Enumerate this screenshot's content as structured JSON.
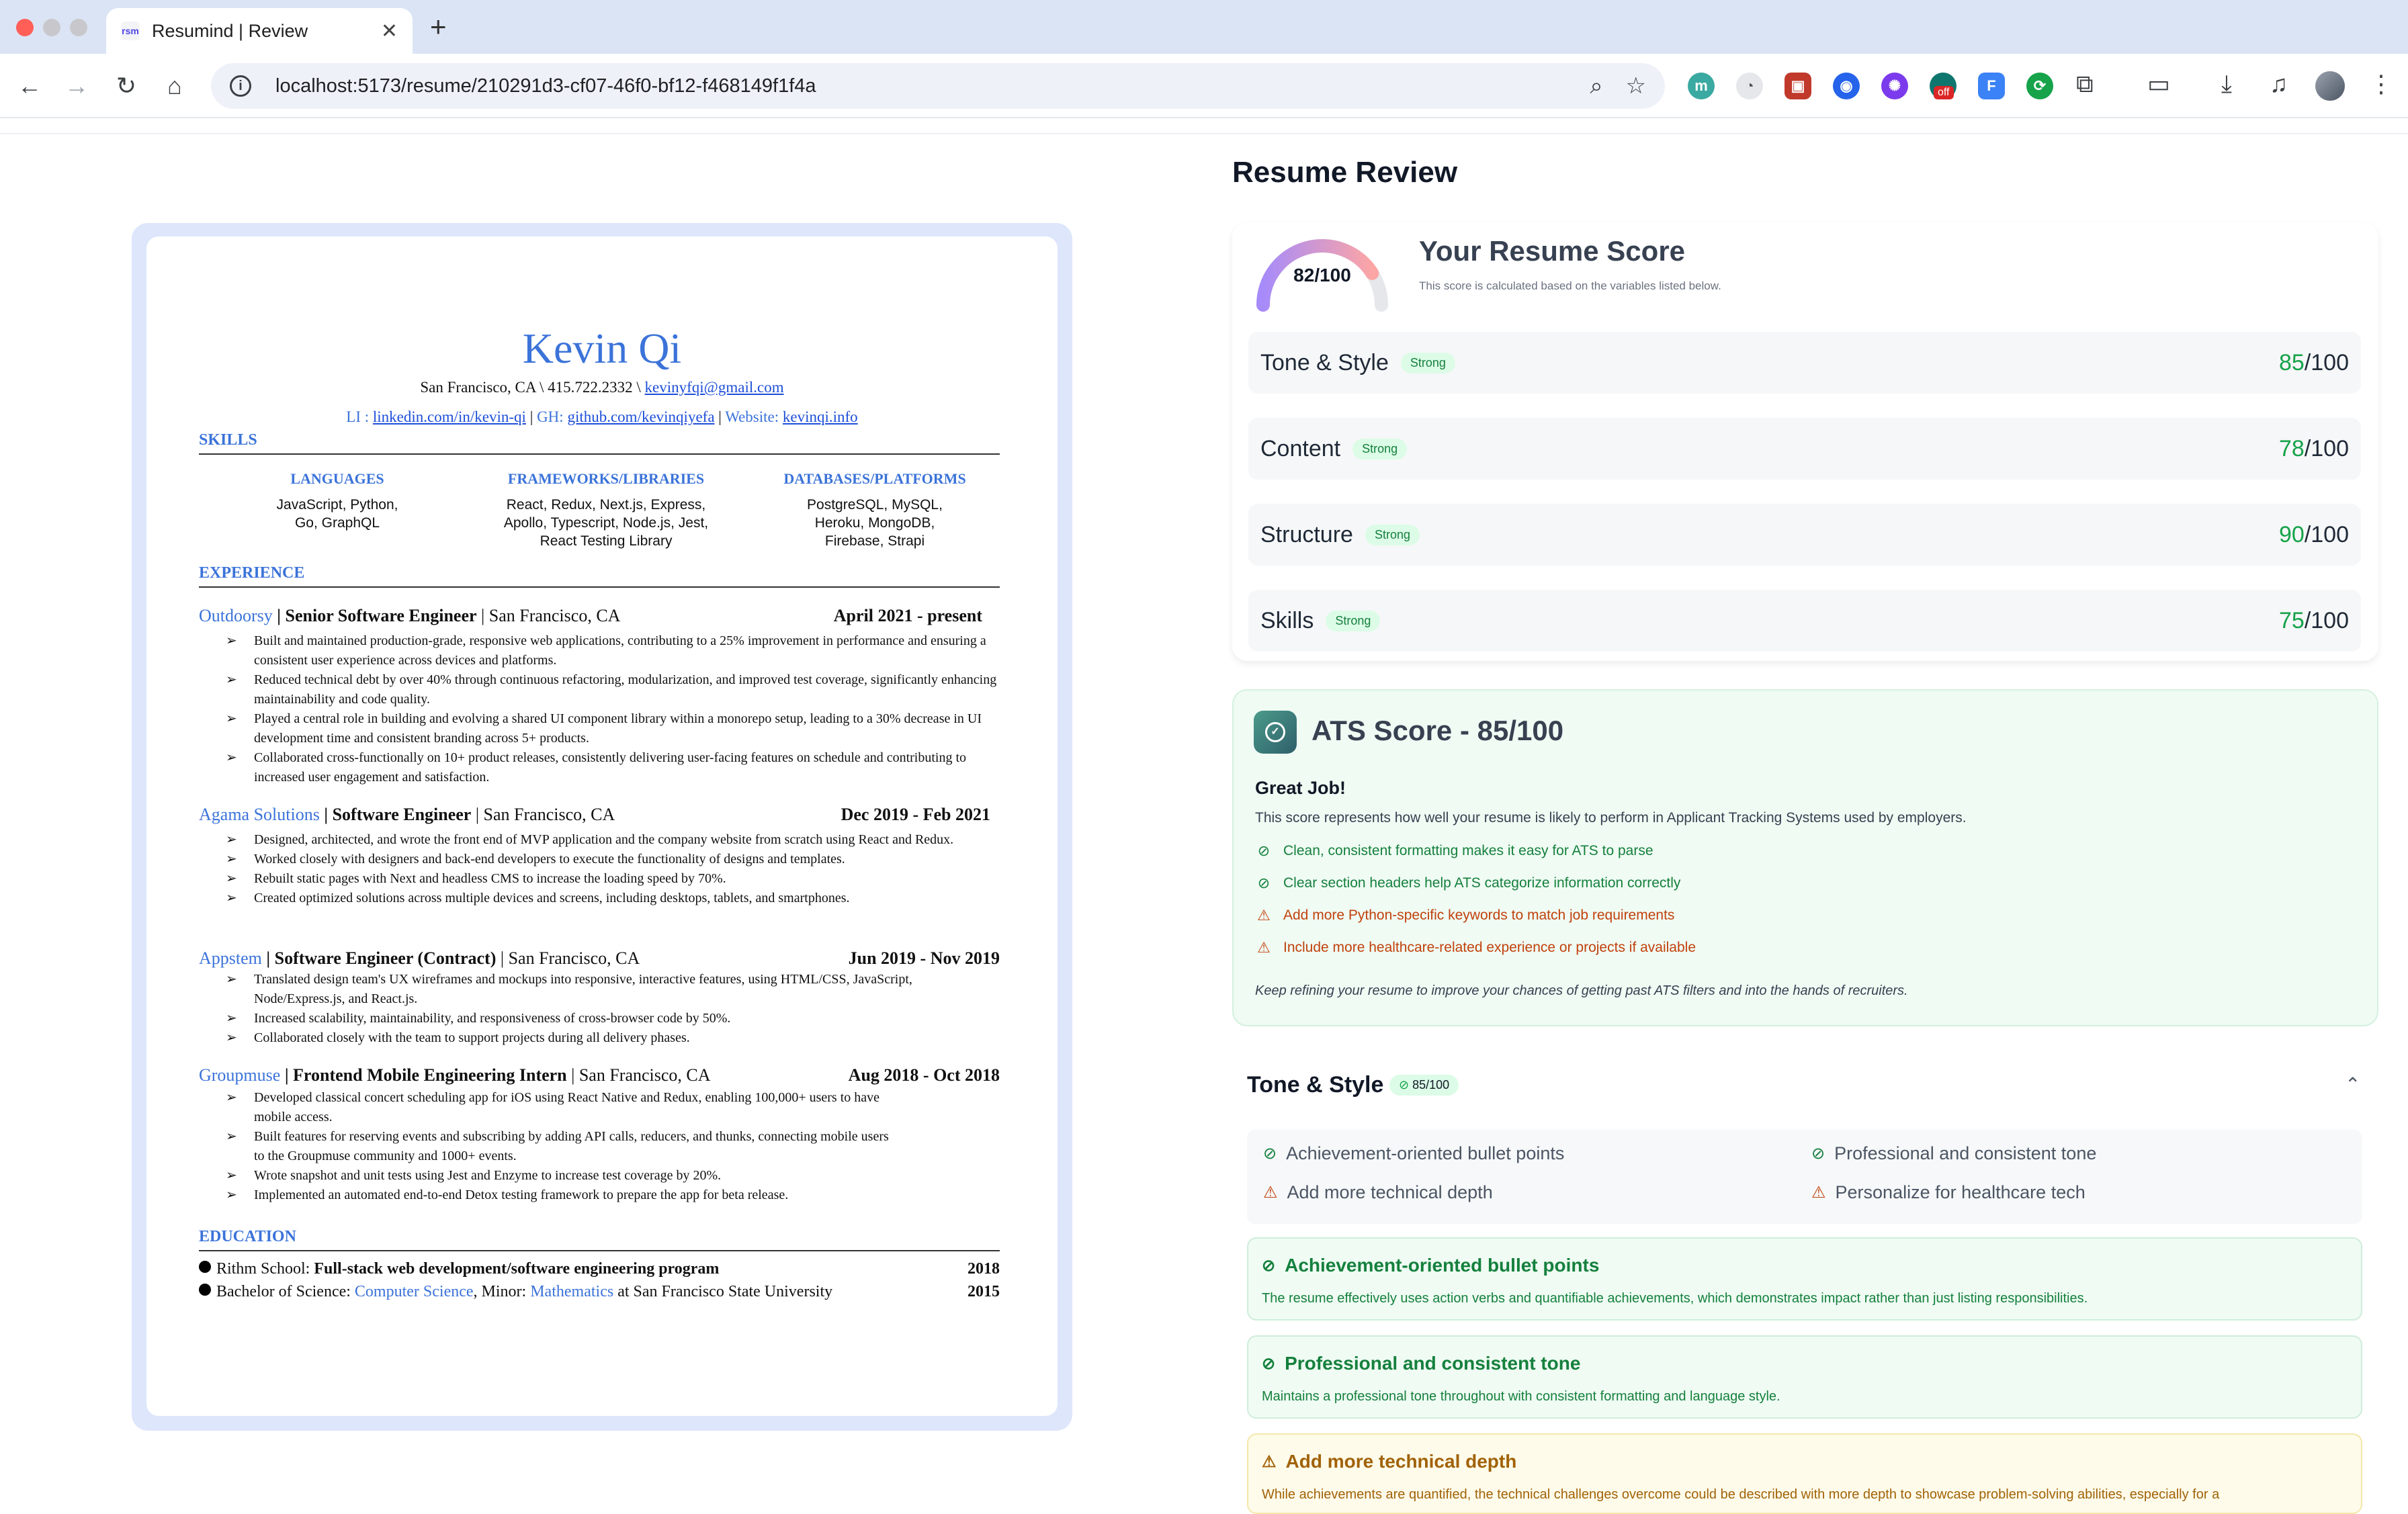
{
  "browser": {
    "tab_title": "Resumind | Review",
    "tab_favicon": "rsm",
    "url": "localhost:5173/resume/210291d3-cf07-46f0-bf12-f468149f1f4a",
    "ext_badge": "off"
  },
  "resume": {
    "name": "Kevin Qi",
    "contact_line": "San Francisco, CA \\ 415.722.2332 \\",
    "email": "kevinyfqi@gmail.com",
    "li_label": "LI :",
    "linkedin": "linkedin.com/in/kevin-qi",
    "gh_label": "GH:",
    "github": "github.com/kevinqiyefa",
    "website_label": "Website:",
    "website": "kevinqi.info",
    "sections": {
      "skills": "SKILLS",
      "experience": "EXPERIENCE",
      "education": "EDUCATION"
    },
    "skills": [
      {
        "heading": "LANGUAGES",
        "l1": "JavaScript, Python,",
        "l2": "Go, GraphQL",
        "l3": ""
      },
      {
        "heading": "FRAMEWORKS/LIBRARIES",
        "l1": "React, Redux, Next.js, Express,",
        "l2": "Apollo, Typescript, Node.js, Jest,",
        "l3": "React Testing Library"
      },
      {
        "heading": "DATABASES/PLATFORMS",
        "l1": "PostgreSQL, MySQL,",
        "l2": "Heroku, MongoDB,",
        "l3": "Firebase, Strapi"
      }
    ],
    "jobs": [
      {
        "company": "Outdoorsy",
        "title": " | Senior Software Engineer",
        "loc": " | San Francisco, CA",
        "date": "April 2021 - present",
        "bullets": [
          "Built and maintained production-grade, responsive web applications, contributing to a 25% improvement in performance and ensuring a consistent user experience across devices and platforms.",
          "Reduced technical debt by over 40% through continuous refactoring, modularization, and improved test coverage, significantly enhancing maintainability and code quality.",
          "Played a central role in building and evolving a shared UI component library within a monorepo setup, leading to a 30% decrease in UI development time and consistent branding across 5+ products.",
          "Collaborated cross-functionally on 10+ product releases, consistently delivering user-facing features on schedule and contributing to increased user engagement and satisfaction."
        ]
      },
      {
        "company": "Agama Solutions",
        "title": " | Software Engineer",
        "loc": " | San Francisco, CA",
        "date": "Dec 2019 - Feb 2021",
        "bullets": [
          "Designed, architected, and wrote the front end of MVP application and the company website from scratch using React and Redux.",
          "Worked closely with designers and back-end developers to execute the functionality of designs and templates.",
          "Rebuilt static pages with Next and headless CMS to increase the loading speed by 70%.",
          "Created optimized solutions across multiple devices and screens, including desktops, tablets, and smartphones."
        ]
      },
      {
        "company": "Appstem",
        "title": " | Software Engineer (Contract)",
        "loc": " | San Francisco, CA",
        "date": "Jun 2019 - Nov 2019",
        "bullets": [
          "Translated design team's UX wireframes and mockups into responsive, interactive features, using HTML/CSS, JavaScript, Node/Express.js, and React.js.",
          "Increased scalability, maintainability, and responsiveness of cross-browser code by 50%.",
          "Collaborated closely with the team to support projects during all delivery phases."
        ]
      },
      {
        "company": "Groupmuse",
        "title": " | Frontend Mobile Engineering Intern",
        "loc": " | San Francisco, CA",
        "date": "Aug 2018 - Oct 2018",
        "bullets": [
          "Developed classical concert scheduling app for iOS using React Native and Redux, enabling  100,000+ users to have mobile access.",
          "Built features for reserving events and subscribing by adding API calls, reducers, and thunks, connecting mobile users to the Groupmuse community and 1000+ events.",
          "Wrote snapshot and unit tests using Jest and Enzyme to increase test coverage by 20%.",
          "Implemented an automated end-to-end Detox testing framework to prepare the app for beta release."
        ]
      }
    ],
    "education": [
      {
        "pre": "Rithm School: ",
        "bold": "Full-stack web development/software engineering program",
        "year": "2018"
      },
      {
        "pre": "Bachelor of Science: ",
        "major": "Computer Science",
        "mid": ",   Minor: ",
        "minor": "Mathematics",
        "post": "  at San Francisco State University",
        "year": "2015"
      }
    ]
  },
  "review": {
    "title": "Resume Review",
    "overall": {
      "score": 82,
      "score_text": "82/100",
      "heading": "Your Resume Score",
      "subtitle": "This score is calculated based on the variables listed below."
    },
    "categories": [
      {
        "name": "Tone & Style",
        "badge": "Strong",
        "score": "85",
        "max": "/100"
      },
      {
        "name": "Content",
        "badge": "Strong",
        "score": "78",
        "max": "/100"
      },
      {
        "name": "Structure",
        "badge": "Strong",
        "score": "90",
        "max": "/100"
      },
      {
        "name": "Skills",
        "badge": "Strong",
        "score": "75",
        "max": "/100"
      }
    ],
    "ats": {
      "heading": "ATS Score - 85/100",
      "great": "Great Job!",
      "desc": "This score represents how well your resume is likely to perform in Applicant Tracking Systems used by employers.",
      "items": [
        {
          "type": "ok",
          "icon": "check-circle-icon",
          "text": "Clean, consistent formatting makes it easy for ATS to parse"
        },
        {
          "type": "ok",
          "icon": "check-circle-icon",
          "text": "Clear section headers help ATS categorize information correctly"
        },
        {
          "type": "warn",
          "icon": "warning-icon",
          "text": "Add more Python-specific keywords to match job requirements"
        },
        {
          "type": "warn",
          "icon": "warning-icon",
          "text": "Include more healthcare-related experience or projects if available"
        }
      ],
      "footer": "Keep refining your resume to improve your chances of getting past ATS filters and into the hands of recruiters."
    },
    "tone": {
      "heading": "Tone & Style",
      "badge": "85/100",
      "summary": [
        {
          "type": "ok",
          "text": "Achievement-oriented bullet points"
        },
        {
          "type": "ok",
          "text": "Professional and consistent tone"
        },
        {
          "type": "warn",
          "text": "Add more technical depth"
        },
        {
          "type": "warn",
          "text": "Personalize for healthcare tech"
        }
      ],
      "details": [
        {
          "type": "good",
          "title": "Achievement-oriented bullet points",
          "body": "The resume effectively uses action verbs and quantifiable achievements, which demonstrates impact rather than just listing responsibilities."
        },
        {
          "type": "good",
          "title": "Professional and consistent tone",
          "body": "Maintains a professional tone throughout with consistent formatting and language style."
        },
        {
          "type": "warn",
          "title": "Add more technical depth",
          "body": "While achievements are quantified, the technical challenges overcome could be described with more depth to showcase problem-solving abilities, especially for a"
        }
      ]
    }
  },
  "colors": {
    "accent": "#3b73d9",
    "success": "#16a34a",
    "warning": "#c2410c",
    "gauge_start": "#a78bfa",
    "gauge_end": "#fca5a5"
  }
}
